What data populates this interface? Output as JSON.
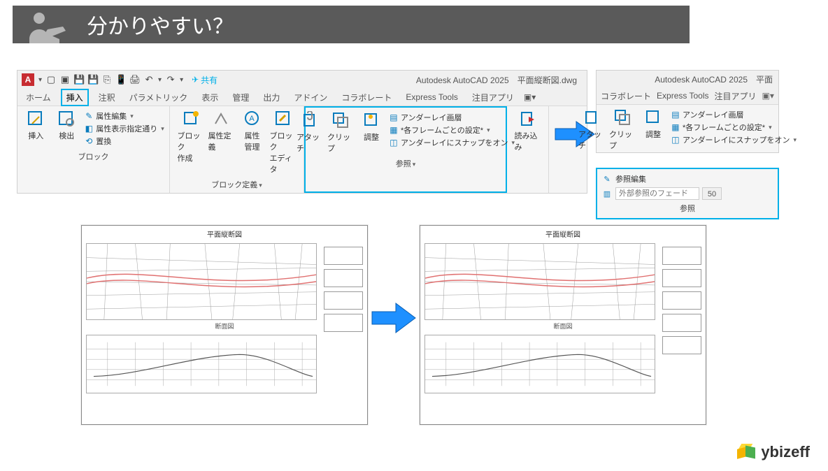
{
  "banner": {
    "title": "分かりやすい？"
  },
  "ribbon1": {
    "app_letter": "A",
    "share": "共有",
    "title_doc": "Autodesk AutoCAD 2025　平面縦断図.dwg",
    "tabs": [
      "ホーム",
      "挿入",
      "注釈",
      "パラメトリック",
      "表示",
      "管理",
      "出力",
      "アドイン",
      "コラボレート",
      "Express Tools",
      "注目アプリ"
    ],
    "active_tab_index": 1,
    "panel_block": {
      "insert": "挿入",
      "detect": "検出",
      "attr_edit": "属性編集",
      "attr_disp": "属性表示指定通り",
      "replace": "置換",
      "label": "ブロック"
    },
    "panel_blockdef": {
      "create": "ブロック\n作成",
      "attr_def": "属性定義",
      "attr_mgr": "属性\n管理",
      "editor": "ブロック\nエディタ",
      "label": "ブロック定義"
    },
    "panel_ref": {
      "attach": "アタッチ",
      "clip": "クリップ",
      "adjust": "調整",
      "underlay_layer": "アンダーレイ画層",
      "frame_setting": "*各フレームごとの設定*",
      "snap_on": "アンダーレイにスナップをオン",
      "label": "参照"
    },
    "panel_import": {
      "import": "読み込み"
    }
  },
  "ribbon2": {
    "title_doc": "Autodesk AutoCAD 2025　平面",
    "tabs": [
      "コラボレート",
      "Express Tools",
      "注目アプリ"
    ],
    "panel_ref": {
      "attach": "アタッチ",
      "clip": "クリップ",
      "adjust": "調整",
      "underlay_layer": "アンダーレイ画層",
      "frame_setting": "*各フレームごとの設定*",
      "snap_on": "アンダーレイにスナップをオン"
    }
  },
  "refpanel": {
    "edit": "参照編集",
    "fade_placeholder": "外部参照のフェード",
    "fade_value": "50",
    "label": "参照"
  },
  "drawing": {
    "title": "平面縦断図",
    "section_label": "断面図"
  },
  "logo": {
    "text": "ybizeff"
  }
}
